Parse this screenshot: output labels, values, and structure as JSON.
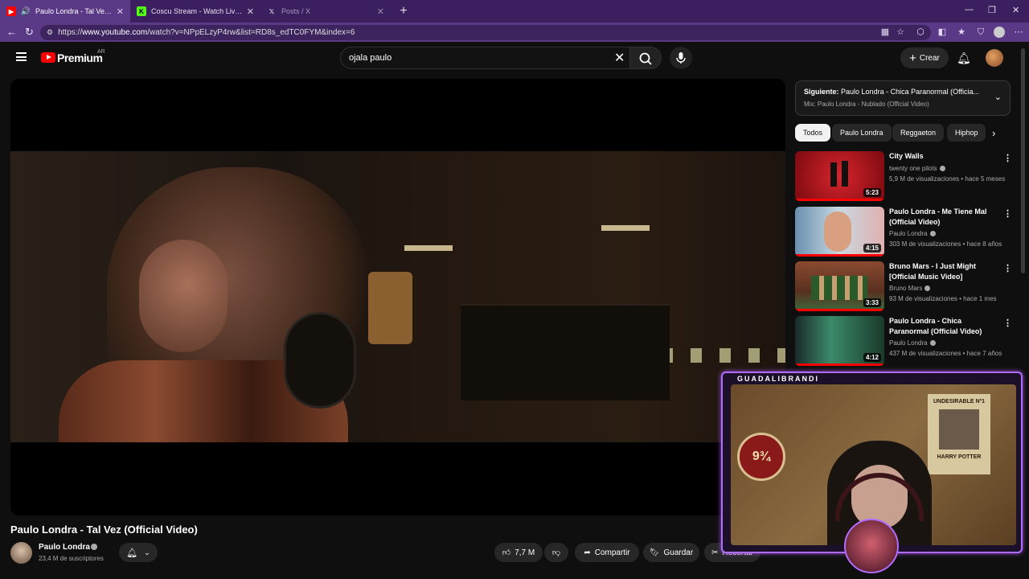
{
  "browser": {
    "tabs": [
      {
        "title": "Paulo Londra - Tal Vez (Officia",
        "active": true
      },
      {
        "title": "Coscu Stream - Watch Live on Kick",
        "active": false
      },
      {
        "title": "Posts / X",
        "active": false
      }
    ],
    "url_prefix": "https://",
    "url_host": "www.youtube.com",
    "url_path": "/watch?v=NPpELzyP4rw&list=RD8s_edTC0FYM&index=6"
  },
  "header": {
    "brand": "Premium",
    "country": "AR",
    "search_value": "ojala paulo",
    "create_label": "Crear"
  },
  "video": {
    "title": "Paulo Londra - Tal Vez (Official Video)",
    "channel": "Paulo Londra",
    "subscribers": "23,4 M de suscriptores",
    "likes": "7,7 M",
    "share_label": "Compartir",
    "save_label": "Guardar",
    "clip_label": "Recortar"
  },
  "upnext": {
    "prefix": "Siguiente:",
    "title": "Paulo Londra - Chica Paranormal (Officia...",
    "mix": "Mix: Paulo Londra - Nublado (Official Video)"
  },
  "chips": [
    "Todos",
    "Paulo Londra",
    "Reggaeton",
    "Hiphop"
  ],
  "recommendations": [
    {
      "title": "City Walls",
      "channel": "twenty one pilots",
      "meta": "5,9 M de visualizaciones • hace 5 meses",
      "duration": "5:23",
      "thumb_color": "#b0141c"
    },
    {
      "title": "Paulo Londra - Me Tiene Mal (Official Video)",
      "channel": "Paulo Londra",
      "meta": "303 M de visualizaciones • hace 8 años",
      "duration": "4:15",
      "thumb_color": "#8fb0c8"
    },
    {
      "title": "Bruno Mars - I Just Might [Official Music Video]",
      "channel": "Bruno Mars",
      "meta": "93 M de visualizaciones • hace 1 mes",
      "duration": "3:33",
      "thumb_color": "#6a3a2a"
    },
    {
      "title": "Paulo Londra - Chica Paranormal (Official Video)",
      "channel": "Paulo Londra",
      "meta": "437 M de visualizaciones • hace 7 años",
      "duration": "4:12",
      "thumb_color": "#3a7a5a"
    }
  ],
  "webcam": {
    "name": "GUADALIBRANDI",
    "sign_text": "9¾",
    "poster_title": "UNDESIRABLE Nº1",
    "poster_name": "HARRY POTTER"
  },
  "colors": {
    "accent": "#ff0000",
    "overlay_border": "#b06bff",
    "browser_frame": "#5a3a86"
  }
}
